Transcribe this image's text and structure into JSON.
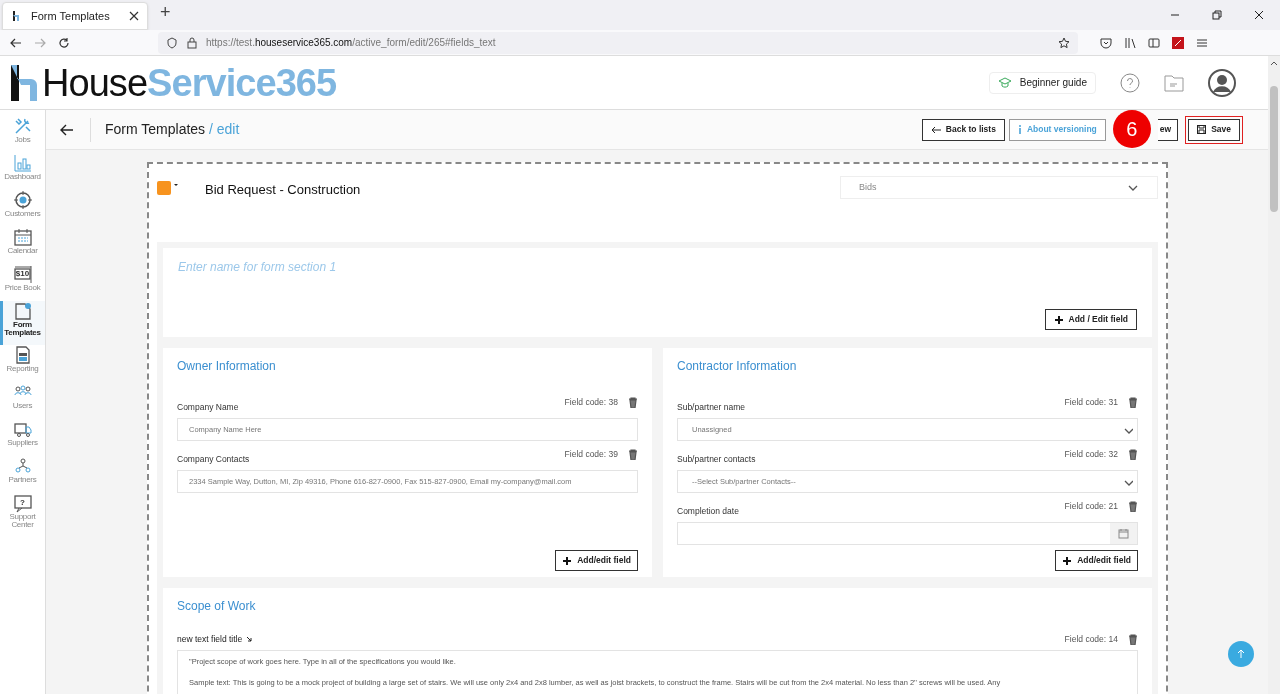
{
  "browser": {
    "tab_title": "Form Templates",
    "new_tab": "+",
    "url_prefix": "https://test.",
    "url_host": "houseservice365.com",
    "url_path": "/active_form/edit/265#fields_text"
  },
  "app": {
    "logo_dark": "House",
    "logo_light": "Service365",
    "guide_button": "Beginner guide"
  },
  "sidebar": {
    "items": [
      {
        "kind": "tools",
        "label": "Jobs",
        "selected": false
      },
      {
        "kind": "chart",
        "label": "Dashboard",
        "selected": false
      },
      {
        "kind": "target",
        "label": "Customers",
        "selected": false
      },
      {
        "kind": "calendar",
        "label": "Calendar",
        "selected": false
      },
      {
        "kind": "price",
        "label": "Price Book",
        "selected": false,
        "icon_text": "$10"
      },
      {
        "kind": "form",
        "label": "Form Templates",
        "selected": true
      },
      {
        "kind": "report",
        "label": "Reporting",
        "selected": false
      },
      {
        "kind": "users",
        "label": "Users",
        "selected": false
      },
      {
        "kind": "truck",
        "label": "Suppliers",
        "selected": false
      },
      {
        "kind": "partners",
        "label": "Partners",
        "selected": false
      },
      {
        "kind": "support",
        "label": "Support Center",
        "selected": false,
        "icon_text": "?"
      }
    ]
  },
  "page_header": {
    "title": "Form Templates",
    "subtitle": "/ edit",
    "buttons": [
      {
        "kind": "back",
        "label": "Back to lists"
      },
      {
        "kind": "info",
        "label": "About versioning"
      },
      {
        "kind": "plain",
        "label": "ew"
      },
      {
        "kind": "save",
        "label": "Save"
      }
    ],
    "step_badge": "6"
  },
  "form": {
    "title": "Bid Request - Construction",
    "color": "#f7931e",
    "category": "Bids",
    "section_1": {
      "placeholder": "Enter name for form section 1",
      "button": "Add / Edit field"
    },
    "cards": [
      {
        "title": "Owner Information",
        "button": "Add/edit field",
        "fields": [
          {
            "kind": "text",
            "label": "Company Name",
            "code": "Field code: 38",
            "placeholder": "Company Name Here"
          },
          {
            "kind": "text",
            "label": "Company Contacts",
            "code": "Field code: 39",
            "placeholder": "2334 Sample Way, Dutton, MI, Zip 49316, Phone 616-827-0900, Fax 515-827-0900, Email my-company@mail.com"
          }
        ]
      },
      {
        "title": "Contractor Information",
        "button": "Add/edit field",
        "fields": [
          {
            "kind": "select",
            "label": "Sub/partner name",
            "code": "Field code: 31",
            "value": "Unassigned"
          },
          {
            "kind": "select",
            "label": "Sub/partner contacts",
            "code": "Field code: 32",
            "value": "--Select Sub/partner Contacts--"
          },
          {
            "kind": "date",
            "label": "Completion date",
            "code": "Field code: 21"
          }
        ]
      }
    ],
    "scope": {
      "title": "Scope of Work",
      "field_label": "new text field title",
      "code": "Field code: 14",
      "lines": [
        "\"Project scope of work goes here. Type in all of the specifications you would like.",
        "Sample text: This is going to be a mock project of building a large set of stairs. We will use only 2x4 and 2x8 lumber, as well as joist brackets, to construct the frame. Stairs will be cut from the 2x4 material. No less than 2'' screws will be used.  Any"
      ]
    }
  }
}
